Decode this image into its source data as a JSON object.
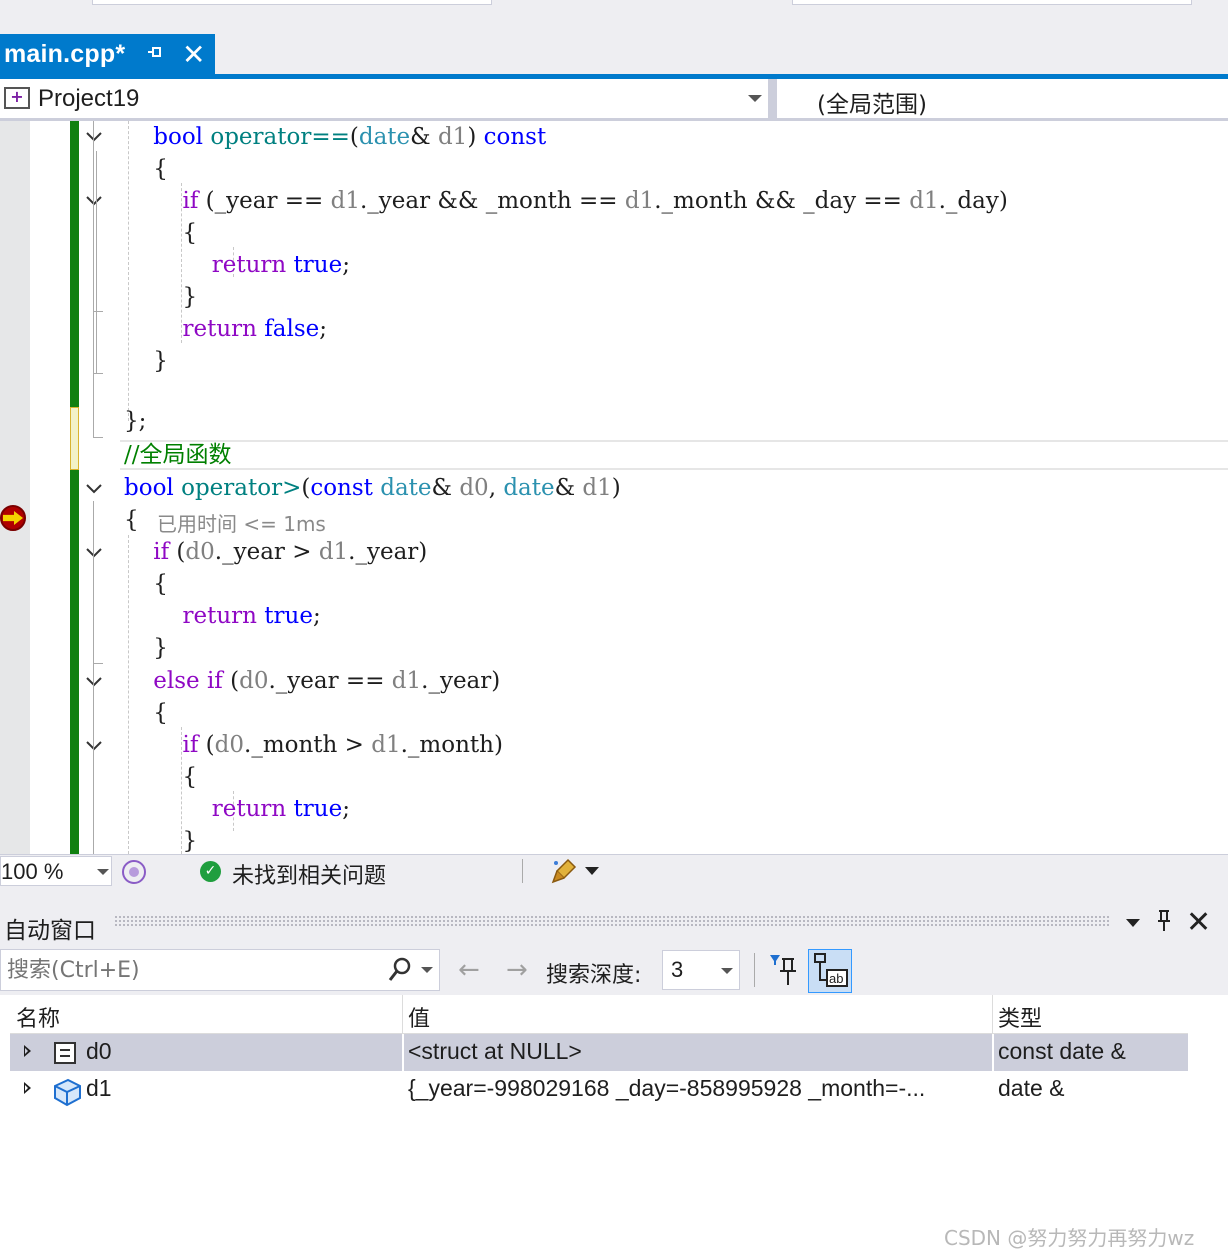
{
  "tab": {
    "title": "main.cpp*",
    "pin_icon": "pin-icon",
    "close_icon": "close-icon"
  },
  "navbar": {
    "project": "Project19",
    "scope": "(全局范围)"
  },
  "editor": {
    "lines": [
      [
        "    ",
        {
          "t": "bool",
          "c": "kw"
        },
        " ",
        {
          "t": "operator==",
          "c": "fn"
        },
        "(",
        {
          "t": "date",
          "c": "ty"
        },
        "& ",
        {
          "t": "d1",
          "c": "par"
        },
        ") ",
        {
          "t": "const",
          "c": "kw"
        }
      ],
      [
        "    {"
      ],
      [
        "        ",
        {
          "t": "if",
          "c": "kw2"
        },
        " (_year == ",
        {
          "t": "d1",
          "c": "par"
        },
        "._year && _month == ",
        {
          "t": "d1",
          "c": "par"
        },
        "._month && _day == ",
        {
          "t": "d1",
          "c": "par"
        },
        "._day)"
      ],
      [
        "        {"
      ],
      [
        "            ",
        {
          "t": "return",
          "c": "kw2"
        },
        " ",
        {
          "t": "true",
          "c": "kw"
        },
        ";"
      ],
      [
        "        }"
      ],
      [
        "        ",
        {
          "t": "return",
          "c": "kw2"
        },
        " ",
        {
          "t": "false",
          "c": "kw"
        },
        ";"
      ],
      [
        "    }"
      ],
      [
        ""
      ],
      [
        "};"
      ],
      [
        {
          "t": "//全局函数",
          "c": "cm"
        }
      ],
      [
        {
          "t": "bool",
          "c": "kw"
        },
        " ",
        {
          "t": "operator>",
          "c": "fn"
        },
        "(",
        {
          "t": "const",
          "c": "kw"
        },
        " ",
        {
          "t": "date",
          "c": "ty"
        },
        "& ",
        {
          "t": "d0",
          "c": "par"
        },
        ", ",
        {
          "t": "date",
          "c": "ty"
        },
        "& ",
        {
          "t": "d1",
          "c": "par"
        },
        ")"
      ],
      [
        "{"
      ],
      [
        "    ",
        {
          "t": "if",
          "c": "kw2"
        },
        " (",
        {
          "t": "d0",
          "c": "par"
        },
        "._year > ",
        {
          "t": "d1",
          "c": "par"
        },
        "._year)"
      ],
      [
        "    {"
      ],
      [
        "        ",
        {
          "t": "return",
          "c": "kw2"
        },
        " ",
        {
          "t": "true",
          "c": "kw"
        },
        ";"
      ],
      [
        "    }"
      ],
      [
        "    ",
        {
          "t": "else",
          "c": "kw2"
        },
        " ",
        {
          "t": "if",
          "c": "kw2"
        },
        " (",
        {
          "t": "d0",
          "c": "par"
        },
        "._year == ",
        {
          "t": "d1",
          "c": "par"
        },
        "._year)"
      ],
      [
        "    {"
      ],
      [
        "        ",
        {
          "t": "if",
          "c": "kw2"
        },
        " (",
        {
          "t": "d0",
          "c": "par"
        },
        "._month > ",
        {
          "t": "d1",
          "c": "par"
        },
        "._month)"
      ],
      [
        "        {"
      ],
      [
        "            ",
        {
          "t": "return",
          "c": "kw2"
        },
        " ",
        {
          "t": "true",
          "c": "kw"
        },
        ";"
      ],
      [
        "        }"
      ]
    ],
    "perf_tip": "已用时间 <= 1ms"
  },
  "status": {
    "zoom": "100 %",
    "issues": "未找到相关问题"
  },
  "autos": {
    "title": "自动窗口",
    "search_placeholder": "搜索(Ctrl+E)",
    "depth_label": "搜索深度:",
    "depth_value": "3",
    "columns": {
      "name": "名称",
      "value": "值",
      "type": "类型"
    },
    "rows": [
      {
        "name": "d0",
        "value": "<struct at NULL>",
        "type": "const date &",
        "icon": "struct-field-icon"
      },
      {
        "name": "d1",
        "value": "{_year=-998029168 _day=-858995928 _month=-...",
        "type": "date &",
        "icon": "class-object-icon"
      }
    ]
  },
  "watermark": "CSDN @努力努力再努力wz",
  "colors": {
    "accent": "#007acc",
    "change_bar": "#108010",
    "keyword": "#0000ff",
    "control": "#8f08c4",
    "type": "#2b91af",
    "comment": "#008000"
  }
}
